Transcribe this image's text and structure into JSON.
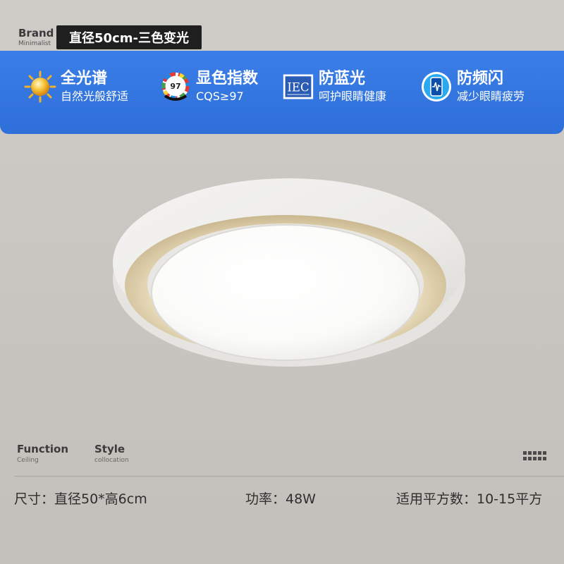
{
  "brand": {
    "name": "Brand",
    "tagline": "Minimalist"
  },
  "product_title": "直径50cm-三色变光",
  "features": [
    {
      "icon": "sun-icon",
      "title": "全光谱",
      "subtitle": "自然光般舒适"
    },
    {
      "icon": "cri-gauge-icon",
      "badge": "97",
      "title": "显色指数",
      "subtitle": "CQS≥97"
    },
    {
      "icon": "iec-logo-icon",
      "badge": "IEC",
      "title": "防蓝光",
      "subtitle": "呵护眼睛健康"
    },
    {
      "icon": "phone-flicker-icon",
      "title": "防频闪",
      "subtitle": "减少眼睛疲劳"
    }
  ],
  "labels": {
    "function_title": "Function",
    "function_sub": "Ceiling",
    "style_title": "Style",
    "style_sub": "collocation"
  },
  "specs": {
    "size": "尺寸：直径50*高6cm",
    "power": "功率：48W",
    "area": "适用平方数：10-15平方"
  },
  "colors": {
    "band_blue": "#2f6fd9",
    "background": "#c9c6c1",
    "title_bg": "#1f1f1f"
  }
}
